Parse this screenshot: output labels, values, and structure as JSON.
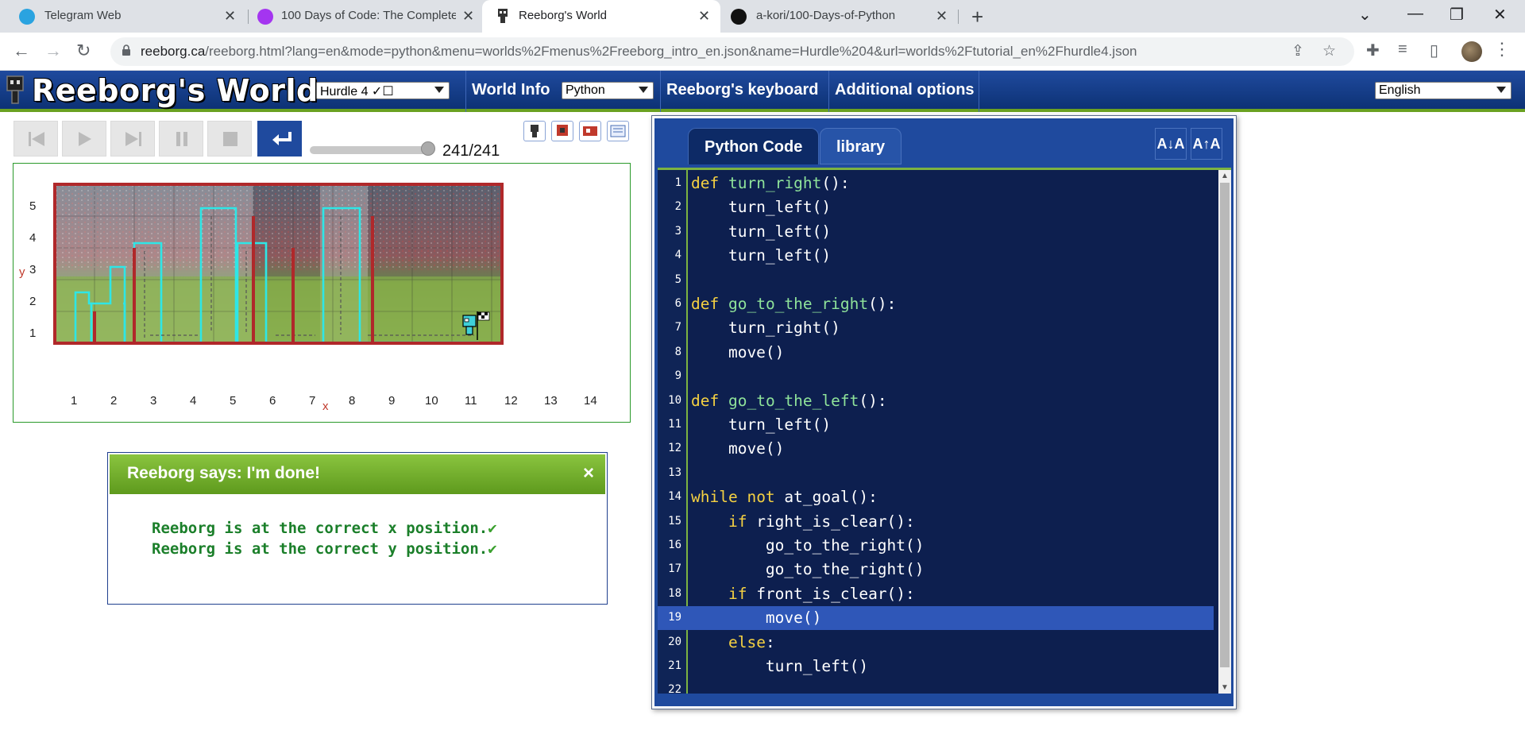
{
  "browser": {
    "tabs": [
      {
        "title": "Telegram Web",
        "icon": "telegram-icon",
        "color": "#2aa3e0"
      },
      {
        "title": "100 Days of Code: The Complete",
        "icon": "udemy-icon",
        "color": "#a435f0"
      },
      {
        "title": "Reeborg's World",
        "icon": "reeborg-icon",
        "color": "#333333"
      },
      {
        "title": "a-kori/100-Days-of-Python",
        "icon": "github-icon",
        "color": "#111111"
      }
    ],
    "url_host": "reeborg.ca",
    "url_rest": "/reeborg.html?lang=en&mode=python&menu=worlds%2Fmenus%2Freeborg_intro_en.json&name=Hurdle%204&url=worlds%2Ftutorial_en%2Fhurdle4.json"
  },
  "header": {
    "logo": "Reeborg's World",
    "world_select": "Hurdle 4 ✓☐",
    "world_info": "World Info",
    "language_mode": "Python",
    "keyboard": "Reeborg's keyboard",
    "additional": "Additional options",
    "ui_language": "English",
    "accent": "#1f4a9e",
    "green": "#6aa121"
  },
  "controls": {
    "step_counter": "241/241",
    "step_progress": 1.0
  },
  "world": {
    "y_labels": [
      "5",
      "4",
      "3",
      "2",
      "1"
    ],
    "x_labels": [
      "1",
      "2",
      "3",
      "4",
      "5",
      "6",
      "7",
      "8",
      "9",
      "10",
      "11",
      "12",
      "13",
      "14"
    ],
    "x_axis": "x",
    "y_axis": "y"
  },
  "dialog": {
    "title": "Reeborg says: I'm done!",
    "close": "×",
    "lines": [
      "Reeborg is at the correct x position.",
      "Reeborg is at the correct y position."
    ]
  },
  "editor": {
    "tab_code": "Python Code",
    "tab_library": "library",
    "font_smaller": "A↓A",
    "font_larger": "A↑A",
    "highlight_line": 19,
    "lines": [
      "def turn_right():",
      "    turn_left()",
      "    turn_left()",
      "    turn_left()",
      "",
      "def go_to_the_right():",
      "    turn_right()",
      "    move()",
      "",
      "def go_to_the_left():",
      "    turn_left()",
      "    move()",
      "",
      "while not at_goal():",
      "    if right_is_clear():",
      "        go_to_the_right()",
      "        go_to_the_right()",
      "    if front_is_clear():",
      "        move()",
      "    else:",
      "        turn_left()",
      ""
    ]
  }
}
